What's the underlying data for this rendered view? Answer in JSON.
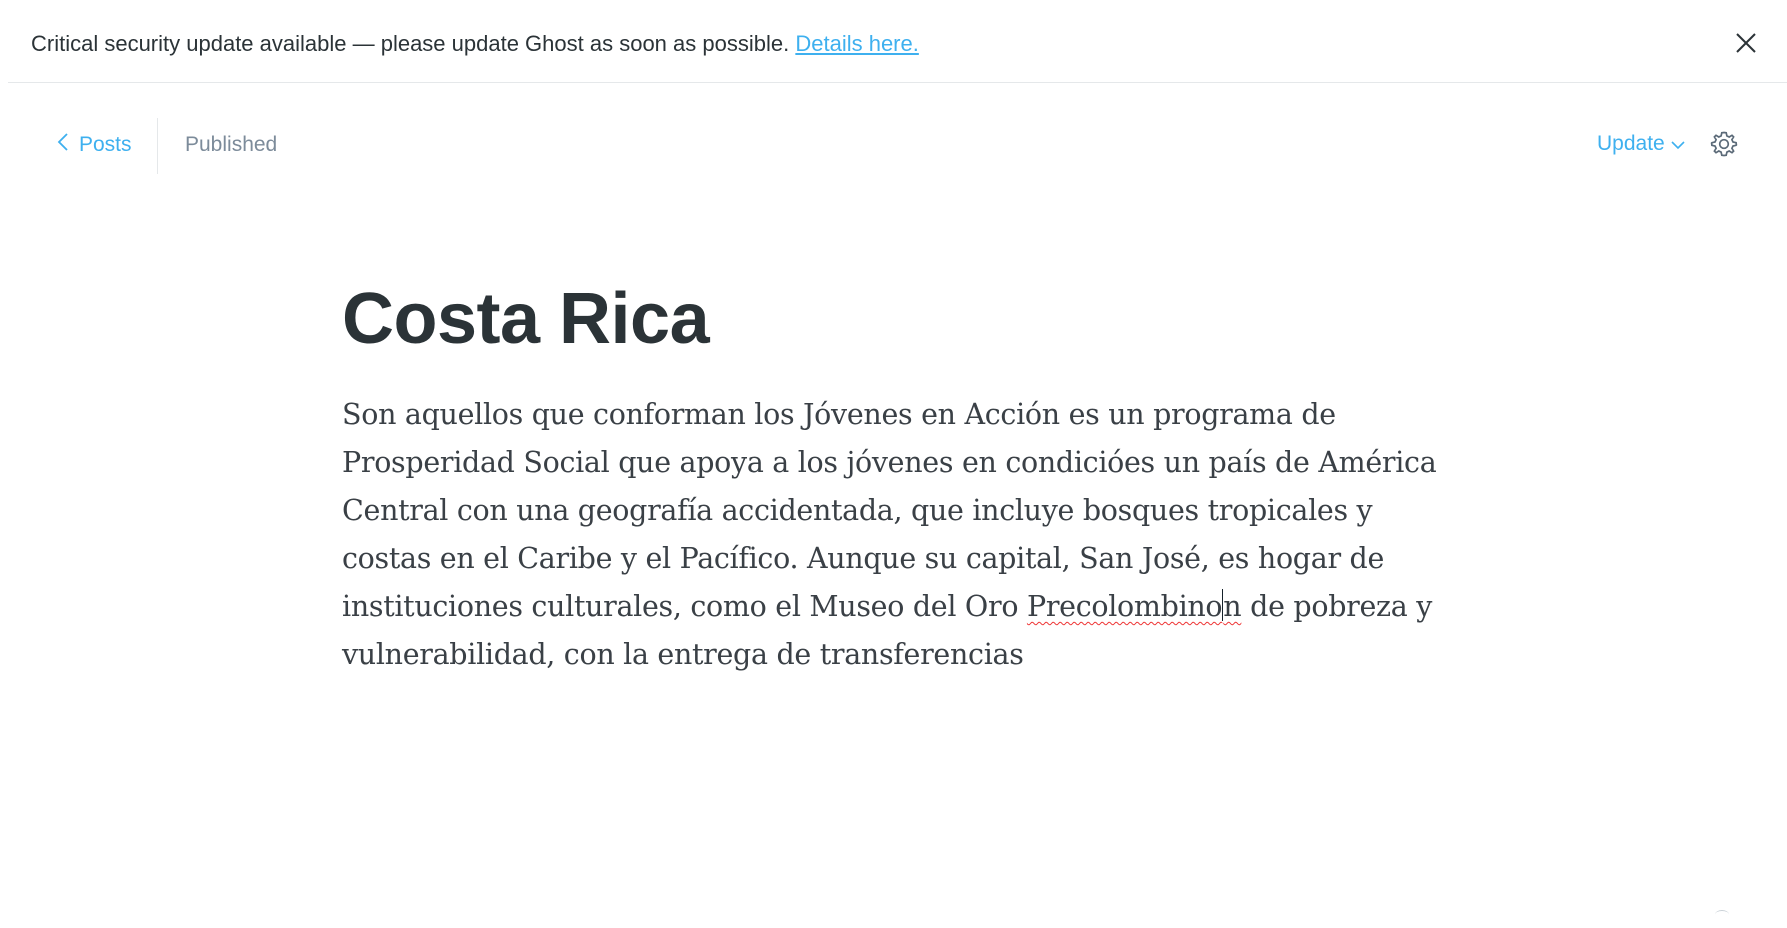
{
  "notice": {
    "message": "Critical security update available — please update Ghost as soon as possible.",
    "link_label": "Details here.",
    "close_icon": "close-icon"
  },
  "header": {
    "back_label": "Posts",
    "back_icon": "chevron-left-icon",
    "status": "Published",
    "update_label": "Update",
    "update_icon": "chevron-down-icon",
    "settings_icon": "gear-icon"
  },
  "post": {
    "title": "Costa Rica",
    "body_before": "Son aquellos que conforman los Jóvenes en Acción es un programa de Prosperidad Social que apoya a los jóvenes en condicióes un país de América Central con una geografía accidentada, que incluye bosques tropicales y costas en el Caribe y el Pacífico. Aunque su capital, San José, es hogar de instituciones culturales, como el Museo del Oro ",
    "misspelled_word_start": "Precolombino",
    "misspelled_word_end": "n",
    "body_after": " de pobreza y vulnerabilidad, con la entrega de transferencias"
  },
  "colors": {
    "accent": "#3eb0ef",
    "text": "#2b3337",
    "muted": "#7c8b9a",
    "divider": "#e5e8ea"
  }
}
